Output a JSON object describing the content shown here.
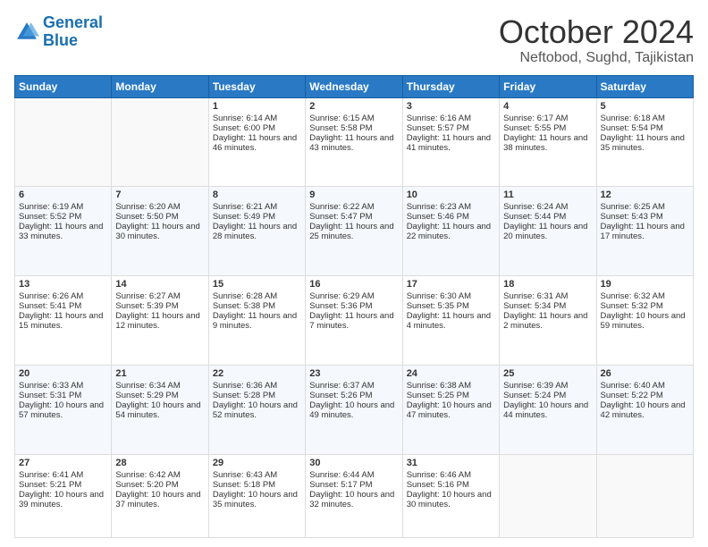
{
  "logo": {
    "line1": "General",
    "line2": "Blue"
  },
  "title": "October 2024",
  "subtitle": "Neftobod, Sughd, Tajikistan",
  "days_header": [
    "Sunday",
    "Monday",
    "Tuesday",
    "Wednesday",
    "Thursday",
    "Friday",
    "Saturday"
  ],
  "weeks": [
    [
      {
        "day": "",
        "sunrise": "",
        "sunset": "",
        "daylight": ""
      },
      {
        "day": "",
        "sunrise": "",
        "sunset": "",
        "daylight": ""
      },
      {
        "day": "1",
        "sunrise": "Sunrise: 6:14 AM",
        "sunset": "Sunset: 6:00 PM",
        "daylight": "Daylight: 11 hours and 46 minutes."
      },
      {
        "day": "2",
        "sunrise": "Sunrise: 6:15 AM",
        "sunset": "Sunset: 5:58 PM",
        "daylight": "Daylight: 11 hours and 43 minutes."
      },
      {
        "day": "3",
        "sunrise": "Sunrise: 6:16 AM",
        "sunset": "Sunset: 5:57 PM",
        "daylight": "Daylight: 11 hours and 41 minutes."
      },
      {
        "day": "4",
        "sunrise": "Sunrise: 6:17 AM",
        "sunset": "Sunset: 5:55 PM",
        "daylight": "Daylight: 11 hours and 38 minutes."
      },
      {
        "day": "5",
        "sunrise": "Sunrise: 6:18 AM",
        "sunset": "Sunset: 5:54 PM",
        "daylight": "Daylight: 11 hours and 35 minutes."
      }
    ],
    [
      {
        "day": "6",
        "sunrise": "Sunrise: 6:19 AM",
        "sunset": "Sunset: 5:52 PM",
        "daylight": "Daylight: 11 hours and 33 minutes."
      },
      {
        "day": "7",
        "sunrise": "Sunrise: 6:20 AM",
        "sunset": "Sunset: 5:50 PM",
        "daylight": "Daylight: 11 hours and 30 minutes."
      },
      {
        "day": "8",
        "sunrise": "Sunrise: 6:21 AM",
        "sunset": "Sunset: 5:49 PM",
        "daylight": "Daylight: 11 hours and 28 minutes."
      },
      {
        "day": "9",
        "sunrise": "Sunrise: 6:22 AM",
        "sunset": "Sunset: 5:47 PM",
        "daylight": "Daylight: 11 hours and 25 minutes."
      },
      {
        "day": "10",
        "sunrise": "Sunrise: 6:23 AM",
        "sunset": "Sunset: 5:46 PM",
        "daylight": "Daylight: 11 hours and 22 minutes."
      },
      {
        "day": "11",
        "sunrise": "Sunrise: 6:24 AM",
        "sunset": "Sunset: 5:44 PM",
        "daylight": "Daylight: 11 hours and 20 minutes."
      },
      {
        "day": "12",
        "sunrise": "Sunrise: 6:25 AM",
        "sunset": "Sunset: 5:43 PM",
        "daylight": "Daylight: 11 hours and 17 minutes."
      }
    ],
    [
      {
        "day": "13",
        "sunrise": "Sunrise: 6:26 AM",
        "sunset": "Sunset: 5:41 PM",
        "daylight": "Daylight: 11 hours and 15 minutes."
      },
      {
        "day": "14",
        "sunrise": "Sunrise: 6:27 AM",
        "sunset": "Sunset: 5:39 PM",
        "daylight": "Daylight: 11 hours and 12 minutes."
      },
      {
        "day": "15",
        "sunrise": "Sunrise: 6:28 AM",
        "sunset": "Sunset: 5:38 PM",
        "daylight": "Daylight: 11 hours and 9 minutes."
      },
      {
        "day": "16",
        "sunrise": "Sunrise: 6:29 AM",
        "sunset": "Sunset: 5:36 PM",
        "daylight": "Daylight: 11 hours and 7 minutes."
      },
      {
        "day": "17",
        "sunrise": "Sunrise: 6:30 AM",
        "sunset": "Sunset: 5:35 PM",
        "daylight": "Daylight: 11 hours and 4 minutes."
      },
      {
        "day": "18",
        "sunrise": "Sunrise: 6:31 AM",
        "sunset": "Sunset: 5:34 PM",
        "daylight": "Daylight: 11 hours and 2 minutes."
      },
      {
        "day": "19",
        "sunrise": "Sunrise: 6:32 AM",
        "sunset": "Sunset: 5:32 PM",
        "daylight": "Daylight: 10 hours and 59 minutes."
      }
    ],
    [
      {
        "day": "20",
        "sunrise": "Sunrise: 6:33 AM",
        "sunset": "Sunset: 5:31 PM",
        "daylight": "Daylight: 10 hours and 57 minutes."
      },
      {
        "day": "21",
        "sunrise": "Sunrise: 6:34 AM",
        "sunset": "Sunset: 5:29 PM",
        "daylight": "Daylight: 10 hours and 54 minutes."
      },
      {
        "day": "22",
        "sunrise": "Sunrise: 6:36 AM",
        "sunset": "Sunset: 5:28 PM",
        "daylight": "Daylight: 10 hours and 52 minutes."
      },
      {
        "day": "23",
        "sunrise": "Sunrise: 6:37 AM",
        "sunset": "Sunset: 5:26 PM",
        "daylight": "Daylight: 10 hours and 49 minutes."
      },
      {
        "day": "24",
        "sunrise": "Sunrise: 6:38 AM",
        "sunset": "Sunset: 5:25 PM",
        "daylight": "Daylight: 10 hours and 47 minutes."
      },
      {
        "day": "25",
        "sunrise": "Sunrise: 6:39 AM",
        "sunset": "Sunset: 5:24 PM",
        "daylight": "Daylight: 10 hours and 44 minutes."
      },
      {
        "day": "26",
        "sunrise": "Sunrise: 6:40 AM",
        "sunset": "Sunset: 5:22 PM",
        "daylight": "Daylight: 10 hours and 42 minutes."
      }
    ],
    [
      {
        "day": "27",
        "sunrise": "Sunrise: 6:41 AM",
        "sunset": "Sunset: 5:21 PM",
        "daylight": "Daylight: 10 hours and 39 minutes."
      },
      {
        "day": "28",
        "sunrise": "Sunrise: 6:42 AM",
        "sunset": "Sunset: 5:20 PM",
        "daylight": "Daylight: 10 hours and 37 minutes."
      },
      {
        "day": "29",
        "sunrise": "Sunrise: 6:43 AM",
        "sunset": "Sunset: 5:18 PM",
        "daylight": "Daylight: 10 hours and 35 minutes."
      },
      {
        "day": "30",
        "sunrise": "Sunrise: 6:44 AM",
        "sunset": "Sunset: 5:17 PM",
        "daylight": "Daylight: 10 hours and 32 minutes."
      },
      {
        "day": "31",
        "sunrise": "Sunrise: 6:46 AM",
        "sunset": "Sunset: 5:16 PM",
        "daylight": "Daylight: 10 hours and 30 minutes."
      },
      {
        "day": "",
        "sunrise": "",
        "sunset": "",
        "daylight": ""
      },
      {
        "day": "",
        "sunrise": "",
        "sunset": "",
        "daylight": ""
      }
    ]
  ]
}
